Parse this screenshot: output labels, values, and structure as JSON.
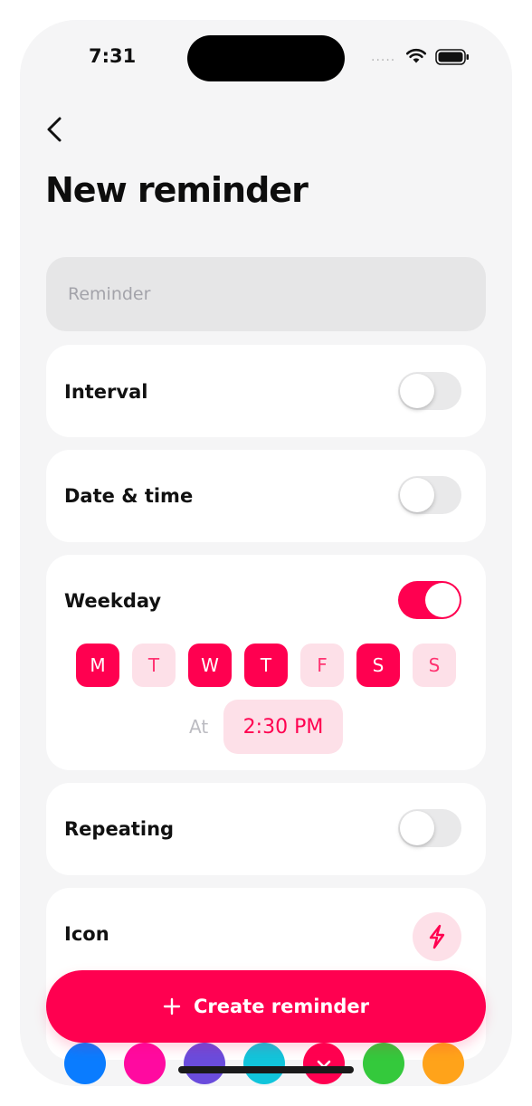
{
  "status": {
    "time": "7:31",
    "signal": "....."
  },
  "header": {
    "title": "New reminder"
  },
  "reminder": {
    "placeholder": "Reminder",
    "value": ""
  },
  "rows": {
    "interval": {
      "label": "Interval",
      "on": false
    },
    "date_time": {
      "label": "Date & time",
      "on": false
    },
    "weekday": {
      "label": "Weekday",
      "on": true
    },
    "repeating": {
      "label": "Repeating",
      "on": false
    },
    "icon": {
      "label": "Icon",
      "icon_name": "lightning-bolt-icon"
    }
  },
  "weekdays": [
    {
      "label": "M",
      "selected": true
    },
    {
      "label": "T",
      "selected": false
    },
    {
      "label": "W",
      "selected": true
    },
    {
      "label": "T",
      "selected": true
    },
    {
      "label": "F",
      "selected": false
    },
    {
      "label": "S",
      "selected": true
    },
    {
      "label": "S",
      "selected": false
    }
  ],
  "time": {
    "at_label": "At",
    "value": "2:30 PM"
  },
  "colors": {
    "accent": "#ff0050",
    "accent_light": "#fde0e8",
    "swatches": [
      "#0a7cff",
      "#ff0aa0",
      "#6a4cdc",
      "#11c5db",
      "#ff0050",
      "#34c93c",
      "#ffa31a"
    ],
    "selected_swatch": 4
  },
  "cta": {
    "label": "Create reminder"
  }
}
